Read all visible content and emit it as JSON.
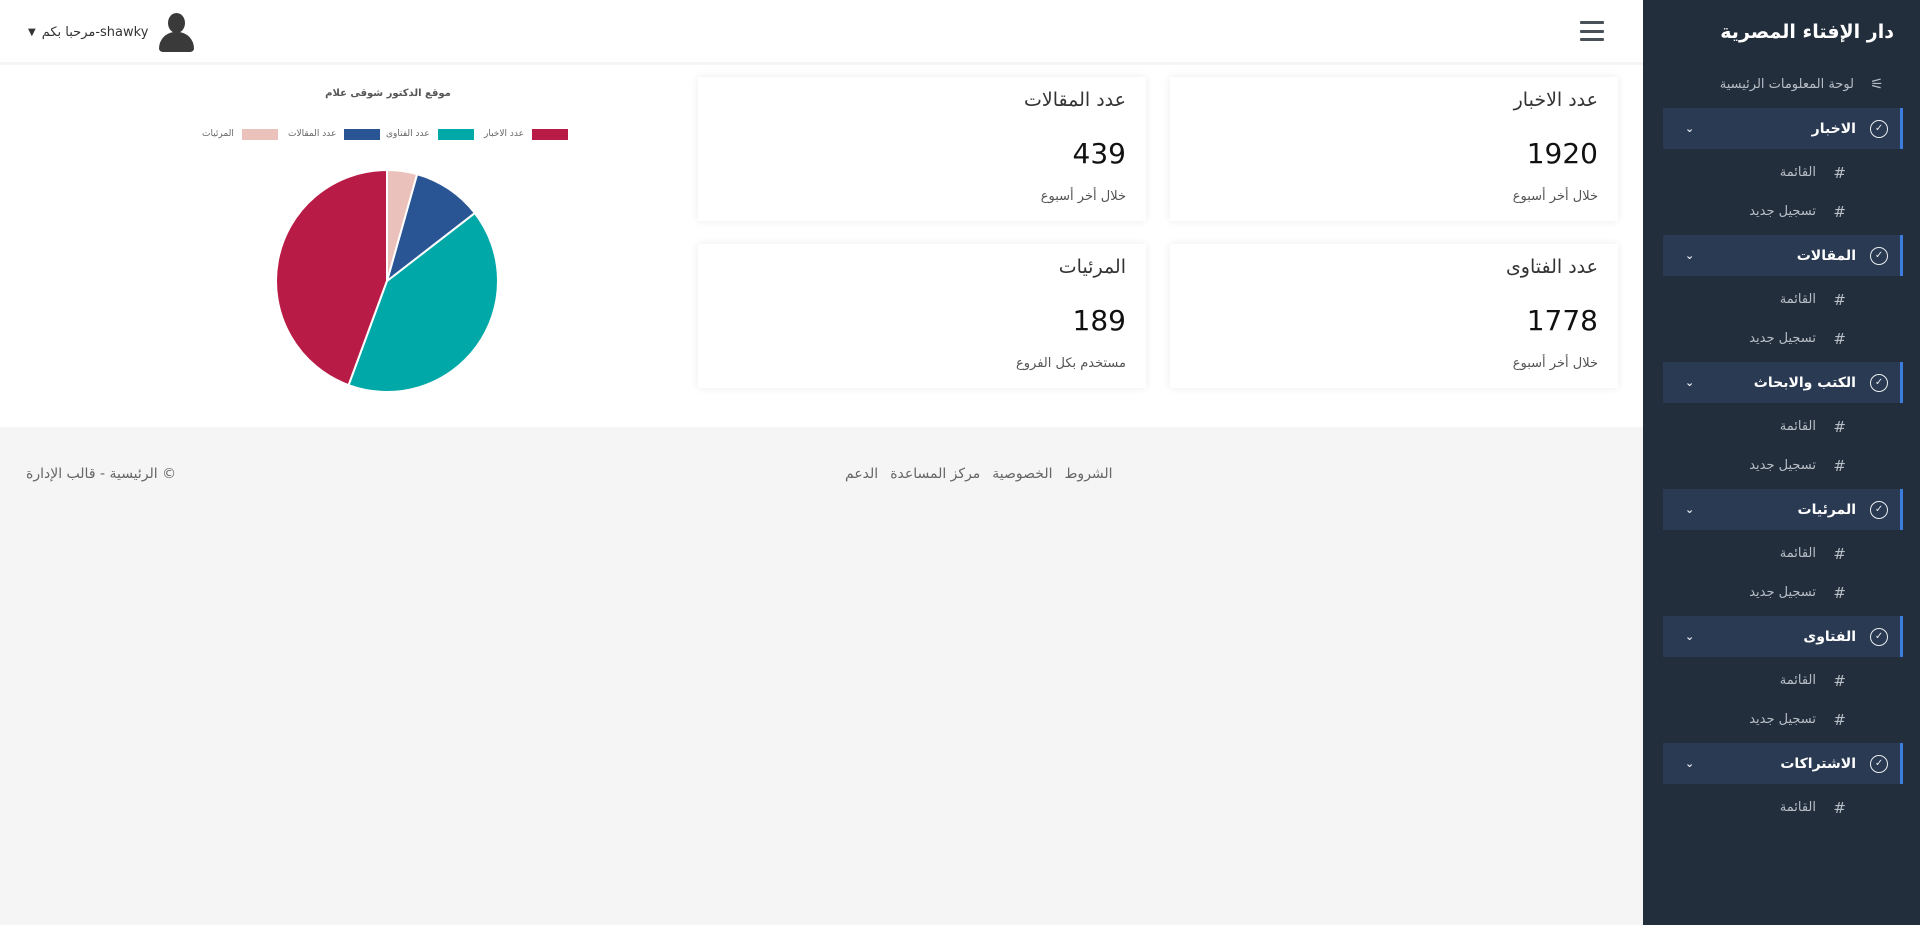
{
  "sidebar": {
    "brand": "دار الإفتاء المصرية",
    "dashboard_label": "لوحة المعلومات الرئيسية",
    "groups": [
      {
        "label": "الاخبار",
        "items": [
          {
            "label": "القائمة"
          },
          {
            "label": "تسجيل جديد"
          }
        ]
      },
      {
        "label": "المقالات",
        "items": [
          {
            "label": "القائمة"
          },
          {
            "label": "تسجيل جديد"
          }
        ]
      },
      {
        "label": "الكتب والابحاث",
        "items": [
          {
            "label": "القائمة"
          },
          {
            "label": "تسجيل جديد"
          }
        ]
      },
      {
        "label": "المرئيات",
        "items": [
          {
            "label": "القائمة"
          },
          {
            "label": "تسجيل جديد"
          }
        ]
      },
      {
        "label": "الفتاوى",
        "items": [
          {
            "label": "القائمة"
          },
          {
            "label": "تسجيل جديد"
          }
        ]
      },
      {
        "label": "الاشتراكات",
        "items": [
          {
            "label": "القائمة"
          }
        ]
      }
    ]
  },
  "header": {
    "user_greeting": "مرحبا بكم-shawky"
  },
  "cards": [
    {
      "title": "عدد الاخبار",
      "value": "1920",
      "subtitle": "خلال أخر أسبوع"
    },
    {
      "title": "عدد المقالات",
      "value": "439",
      "subtitle": "خلال أخر أسبوع"
    },
    {
      "title": "عدد الفتاوى",
      "value": "1778",
      "subtitle": "خلال أخر أسبوع"
    },
    {
      "title": "المرئيات",
      "value": "189",
      "subtitle": "مستخدم بكل الفروع"
    }
  ],
  "chart_data": {
    "type": "pie",
    "title": "موقع الدكتور شوقى علام",
    "legend_position": "top",
    "categories": [
      "عدد الاخبار",
      "عدد الفتاوى",
      "عدد المقالات",
      "المرئيات"
    ],
    "values": [
      1920,
      1778,
      439,
      189
    ],
    "colors": [
      "#b81c46",
      "#00a8a8",
      "#2a5595",
      "#eac1bb"
    ]
  },
  "footer": {
    "links": [
      "الشروط",
      "الخصوصية",
      "مركز المساعدة",
      "الدعم"
    ],
    "copyright": "© الرئيسية - قالب الإدارة"
  }
}
